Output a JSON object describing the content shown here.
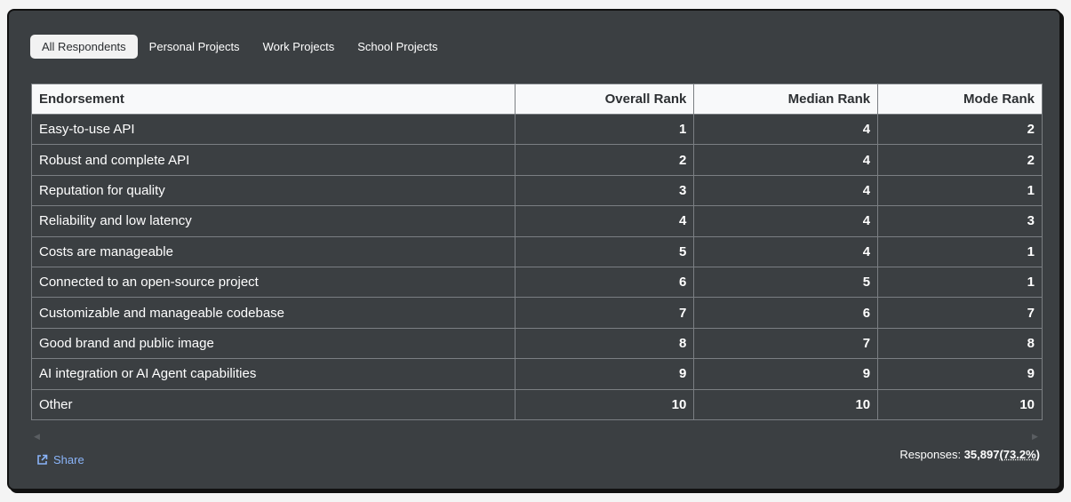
{
  "tabs": [
    {
      "label": "All Respondents",
      "active": true
    },
    {
      "label": "Personal Projects",
      "active": false
    },
    {
      "label": "Work Projects",
      "active": false
    },
    {
      "label": "School Projects",
      "active": false
    }
  ],
  "table": {
    "headers": [
      "Endorsement",
      "Overall Rank",
      "Median Rank",
      "Mode Rank"
    ],
    "rows": [
      [
        "Easy-to-use API",
        "1",
        "4",
        "2"
      ],
      [
        "Robust and complete API",
        "2",
        "4",
        "2"
      ],
      [
        "Reputation for quality",
        "3",
        "4",
        "1"
      ],
      [
        "Reliability and low latency",
        "4",
        "4",
        "3"
      ],
      [
        "Costs are manageable",
        "5",
        "4",
        "1"
      ],
      [
        "Connected to an open-source project",
        "6",
        "5",
        "1"
      ],
      [
        "Customizable and manageable codebase",
        "7",
        "6",
        "7"
      ],
      [
        "Good brand and public image",
        "8",
        "7",
        "8"
      ],
      [
        "AI integration or AI Agent capabilities",
        "9",
        "9",
        "9"
      ],
      [
        "Other",
        "10",
        "10",
        "10"
      ]
    ]
  },
  "footer": {
    "share_label": "Share",
    "share_icon": "external-link-icon",
    "responses_label": "Responses:",
    "responses_count": "35,897",
    "responses_pct": "(73.2%)"
  },
  "colors": {
    "card_bg": "#3b3f42",
    "header_bg": "#f8f9fa",
    "link": "#8ab4f8"
  }
}
